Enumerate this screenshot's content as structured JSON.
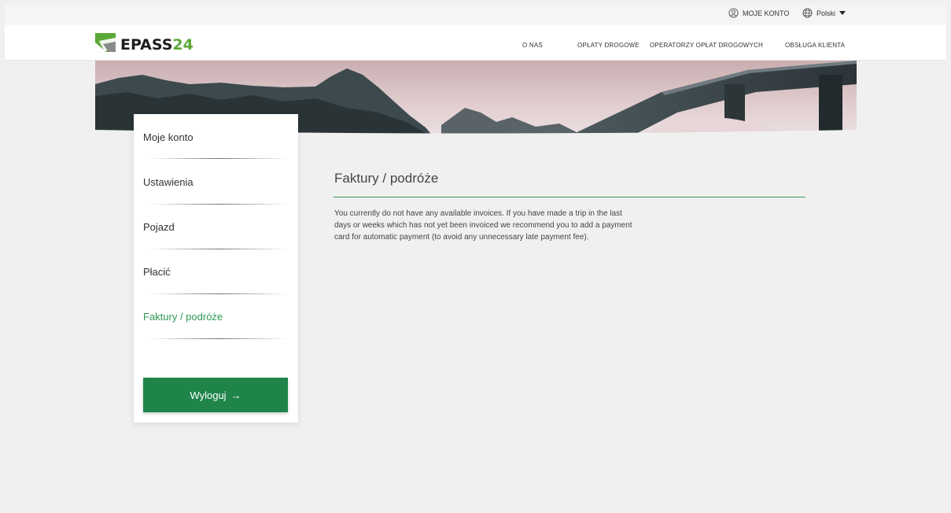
{
  "topbar": {
    "account_label": "MOJE KONTO",
    "language_label": "Polski"
  },
  "brand": {
    "name_part1": "EPASS",
    "name_part2": "24"
  },
  "nav": {
    "items": [
      "O NAS",
      "OPŁATY DROGOWE",
      "OPERATORZY OPŁAT DROGOWYCH",
      "OBSŁUGA KLIENTA"
    ]
  },
  "sidebar": {
    "items": [
      {
        "label": "Moje konto"
      },
      {
        "label": "Ustawienia"
      },
      {
        "label": "Pojazd"
      },
      {
        "label": "Płacić"
      },
      {
        "label": "Faktury / podróże",
        "active": true
      }
    ],
    "logout_label": "Wyloguj",
    "logout_arrow": "→"
  },
  "content": {
    "title": "Faktury / podróże",
    "message_lines": [
      "You currently do not have any available invoices. If you have made a trip in the last",
      "days or weeks which has not yet been invoiced we recommend you to add a payment",
      "card for automatic payment (to avoid any unnecessary late payment fee)."
    ]
  },
  "colors": {
    "accent": "#2e9a52",
    "button": "#1e8449",
    "logo_green": "#5ba838",
    "background": "#f0f0f0"
  }
}
